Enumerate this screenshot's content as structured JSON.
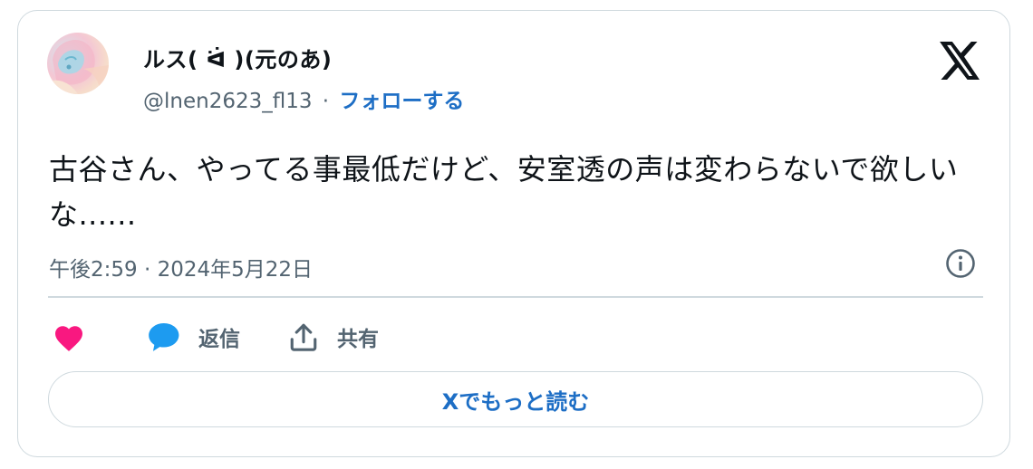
{
  "author": {
    "display_name": "ルス( ᐛ )(元のあ)",
    "handle": "@lnen2623_fl13",
    "separator": "·",
    "follow_label": "フォローする"
  },
  "tweet": {
    "text": "古谷さん、やってる事最低だけど、安室透の声は変わらないで欲しいな......",
    "timestamp": "午後2:59 · 2024年5月22日"
  },
  "actions": {
    "reply_label": "返信",
    "share_label": "共有"
  },
  "read_more_label": "Xでもっと読む",
  "icons": {
    "brand": "x-logo-icon",
    "info": "info-icon",
    "like": "heart-icon",
    "reply": "speech-bubble-icon",
    "share": "share-upload-icon"
  },
  "colors": {
    "link": "#1d6ec5",
    "heart": "#f91880",
    "reply": "#1d9bf0",
    "muted": "#536471",
    "border": "#cfd9de"
  }
}
